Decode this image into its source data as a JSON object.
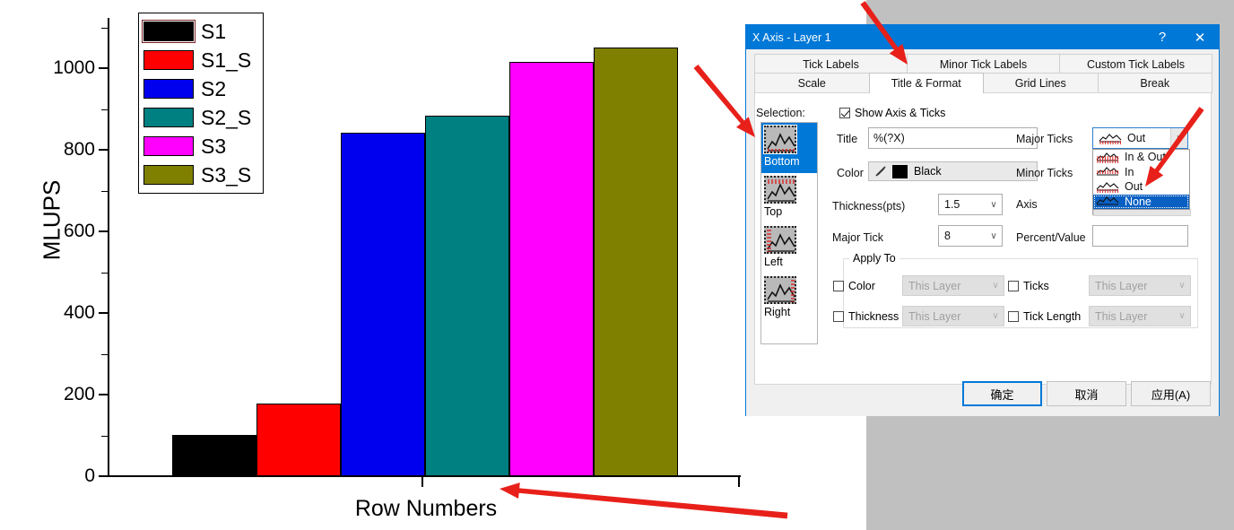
{
  "chart_data": {
    "type": "bar",
    "title": "",
    "xlabel": "Row Numbers",
    "ylabel": "MLUPS",
    "categories": [
      "S1",
      "S1_S",
      "S2",
      "S2_S",
      "S3",
      "S3_S"
    ],
    "values": [
      101,
      178,
      842,
      884,
      1015,
      1051
    ],
    "colors": [
      "#000000",
      "#ff0000",
      "#0000ee",
      "#008080",
      "#ff00ff",
      "#808000"
    ],
    "ylim": [
      0,
      1130
    ],
    "yticks": [
      0,
      200,
      400,
      600,
      800,
      1000
    ],
    "ytick_labels": [
      "0",
      "200",
      "400",
      "600",
      "800",
      "1000"
    ],
    "minor_ticks": true,
    "grid": false,
    "legend_position": "top-left",
    "legend_entries": [
      {
        "label": "S1",
        "color": "#000000",
        "selected": true
      },
      {
        "label": "S1_S",
        "color": "#ff0000",
        "selected": false
      },
      {
        "label": "S2",
        "color": "#0000ee",
        "selected": false
      },
      {
        "label": "S2_S",
        "color": "#008080",
        "selected": false
      },
      {
        "label": "S3",
        "color": "#ff00ff",
        "selected": false
      },
      {
        "label": "S3_S",
        "color": "#808000",
        "selected": false
      }
    ]
  },
  "dialog": {
    "title": "X Axis - Layer 1",
    "help_glyph": "?",
    "close_glyph": "✕",
    "tabs_row1": [
      {
        "label": "Tick Labels",
        "active": false
      },
      {
        "label": "Minor Tick Labels",
        "active": false
      },
      {
        "label": "Custom Tick Labels",
        "active": false
      }
    ],
    "tabs_row2": [
      {
        "label": "Scale",
        "active": false
      },
      {
        "label": "Title & Format",
        "active": true
      },
      {
        "label": "Grid Lines",
        "active": false
      },
      {
        "label": "Break",
        "active": false
      }
    ],
    "selection": {
      "label": "Selection:",
      "items": [
        {
          "label": "Bottom",
          "selected": true
        },
        {
          "label": "Top",
          "selected": false
        },
        {
          "label": "Left",
          "selected": false
        },
        {
          "label": "Right",
          "selected": false
        }
      ]
    },
    "show_axis_ticks": {
      "label": "Show Axis & Ticks",
      "checked": true
    },
    "fields": {
      "title_label": "Title",
      "title_value": "%(?X)",
      "color_label": "Color",
      "color_value": "Black",
      "color_swatch": "#000000",
      "thickness_label": "Thickness(pts)",
      "thickness_value": "1.5",
      "major_tick_label": "Major Tick",
      "major_tick_value": "8",
      "major_ticks_label": "Major Ticks",
      "major_ticks_value": "Out",
      "minor_ticks_label": "Minor Ticks",
      "axis_label": "Axis",
      "percent_value_label": "Percent/Value",
      "percent_value_value": ""
    },
    "major_ticks_options": [
      {
        "label": "In & Out",
        "selected": false
      },
      {
        "label": "In",
        "selected": false
      },
      {
        "label": "Out",
        "selected": false
      },
      {
        "label": "None",
        "selected": true
      }
    ],
    "apply_to": {
      "legend": "Apply To",
      "rows": [
        {
          "label": "Color",
          "checked": false,
          "value": "This Layer"
        },
        {
          "label": "Thickness",
          "checked": false,
          "value": "This Layer"
        }
      ],
      "rows_right": [
        {
          "label": "Ticks",
          "checked": false,
          "value": "This Layer"
        },
        {
          "label": "Tick Length",
          "checked": false,
          "value": "This Layer"
        }
      ]
    },
    "buttons": [
      {
        "label": "确定",
        "default": true
      },
      {
        "label": "取消",
        "default": false
      },
      {
        "label": "应用(A)",
        "default": false
      }
    ]
  },
  "annotations": {
    "arrow_color": "#e8201a",
    "arrows": [
      {
        "name": "arrow-to-title-format-tab"
      },
      {
        "name": "arrow-to-selection-bottom"
      },
      {
        "name": "arrow-to-none-option"
      },
      {
        "name": "arrow-to-row-numbers-label"
      }
    ]
  }
}
